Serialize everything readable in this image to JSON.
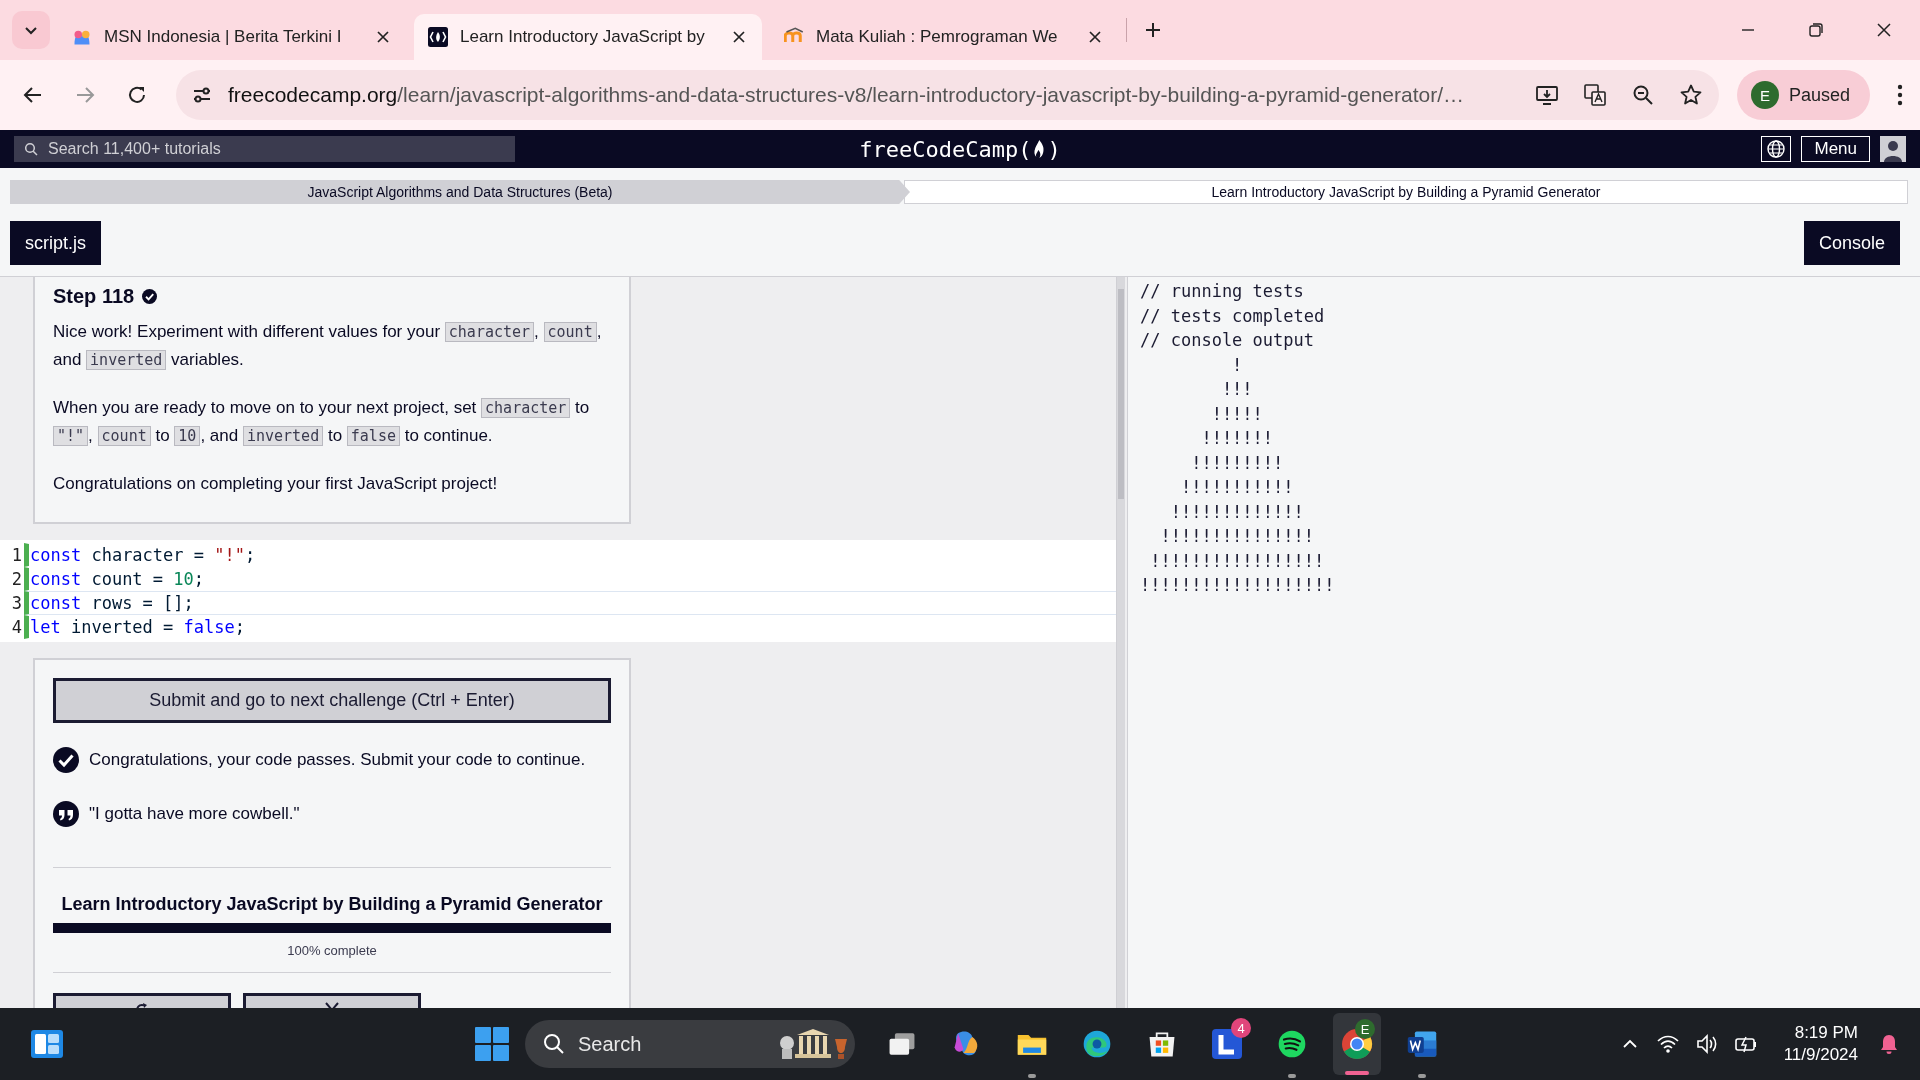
{
  "browser": {
    "tabs": [
      {
        "title": "MSN Indonesia | Berita Terkini I",
        "selected": false
      },
      {
        "title": "Learn Introductory JavaScript by",
        "selected": true
      },
      {
        "title": "Mata Kuliah : Pemrograman We",
        "selected": false
      }
    ],
    "url": "freecodecamp.org/learn/javascript-algorithms-and-data-structures-v8/learn-introductory-javascript-by-building-a-pyramid-generator/…",
    "profile": {
      "initial": "E",
      "label": "Paused"
    }
  },
  "nav": {
    "search": {
      "placeholder": "Search 11,400+ tutorials"
    },
    "logo": {
      "name": "freeCodeCamp",
      "open": "(",
      "close": ")"
    },
    "menu": "Menu"
  },
  "breadcrumb": [
    "JavaScript Algorithms and Data Structures (Beta)",
    "Learn Introductory JavaScript by Building a Pyramid Generator"
  ],
  "toolbar": {
    "file_tab": "script.js",
    "console_tab": "Console"
  },
  "instructions": {
    "step": "Step 118",
    "completed": true,
    "paragraphs": [
      [
        {
          "kind": "text",
          "text": "Nice work! Experiment with different values for your "
        },
        {
          "kind": "code",
          "text": "character"
        },
        {
          "kind": "text",
          "text": ", "
        },
        {
          "kind": "code",
          "text": "count"
        },
        {
          "kind": "text",
          "text": ", and "
        },
        {
          "kind": "code",
          "text": "inverted"
        },
        {
          "kind": "text",
          "text": " variables."
        }
      ],
      [
        {
          "kind": "text",
          "text": "When you are ready to move on to your next project, set "
        },
        {
          "kind": "code",
          "text": "character"
        },
        {
          "kind": "text",
          "text": " to "
        },
        {
          "kind": "code",
          "text": "\"!\""
        },
        {
          "kind": "text",
          "text": ", "
        },
        {
          "kind": "code",
          "text": "count"
        },
        {
          "kind": "text",
          "text": " to "
        },
        {
          "kind": "code",
          "text": "10"
        },
        {
          "kind": "text",
          "text": ", and "
        },
        {
          "kind": "code",
          "text": "inverted"
        },
        {
          "kind": "text",
          "text": " to "
        },
        {
          "kind": "code",
          "text": "false"
        },
        {
          "kind": "text",
          "text": " to continue."
        }
      ],
      [
        {
          "kind": "text",
          "text": "Congratulations on completing your first JavaScript project!"
        }
      ]
    ]
  },
  "editor": {
    "lines": [
      {
        "number": "1",
        "active": false,
        "tokens": [
          {
            "kind": "keyword",
            "text": "const"
          },
          {
            "kind": "plain",
            "text": " character = "
          },
          {
            "kind": "string",
            "text": "\"!\""
          },
          {
            "kind": "plain",
            "text": ";"
          }
        ]
      },
      {
        "number": "2",
        "active": false,
        "tokens": [
          {
            "kind": "keyword",
            "text": "const"
          },
          {
            "kind": "plain",
            "text": " count = "
          },
          {
            "kind": "number",
            "text": "10"
          },
          {
            "kind": "plain",
            "text": ";"
          }
        ]
      },
      {
        "number": "3",
        "active": true,
        "tokens": [
          {
            "kind": "keyword",
            "text": "const"
          },
          {
            "kind": "plain",
            "text": " rows = [];"
          }
        ]
      },
      {
        "number": "4",
        "active": false,
        "tokens": [
          {
            "kind": "keyword",
            "text": "let"
          },
          {
            "kind": "plain",
            "text": " inverted = "
          },
          {
            "kind": "keyword",
            "text": "false"
          },
          {
            "kind": "plain",
            "text": ";"
          }
        ]
      }
    ]
  },
  "results": {
    "submit": "Submit and go to next challenge (Ctrl + Enter)",
    "passed": true,
    "message": "Congratulations, your code passes. Submit your code to continue.",
    "quote": "\"I gotta have more cowbell.\"",
    "project_title": "Learn Introductory JavaScript by Building a Pyramid Generator",
    "progress": {
      "level": 1,
      "label": "100% complete"
    },
    "cut_buttons": [
      {
        "kind": "reset"
      },
      {
        "kind": "tweet"
      }
    ]
  },
  "console": {
    "lines": [
      "// running tests",
      "// tests completed",
      "// console output",
      "         !",
      "        !!!",
      "       !!!!!",
      "      !!!!!!!",
      "     !!!!!!!!!",
      "    !!!!!!!!!!!",
      "   !!!!!!!!!!!!!",
      "  !!!!!!!!!!!!!!!",
      " !!!!!!!!!!!!!!!!!",
      "!!!!!!!!!!!!!!!!!!!"
    ]
  },
  "taskbar": {
    "search": {
      "placeholder": "Search"
    },
    "apps": [
      {
        "kind": "taskview",
        "running": false,
        "active": false
      },
      {
        "kind": "copilot",
        "running": false,
        "active": false
      },
      {
        "kind": "explorer",
        "running": true,
        "active": false
      },
      {
        "kind": "edge",
        "running": false,
        "active": false
      },
      {
        "kind": "store",
        "running": false,
        "active": false
      },
      {
        "kind": "l-app",
        "running": false,
        "active": false,
        "badge": "4"
      },
      {
        "kind": "spotify",
        "running": true,
        "active": false
      },
      {
        "kind": "chrome",
        "running": true,
        "active": true,
        "badge": "E"
      },
      {
        "kind": "word",
        "running": true,
        "active": false
      }
    ],
    "time": "8:19 PM",
    "date": "11/9/2024"
  }
}
